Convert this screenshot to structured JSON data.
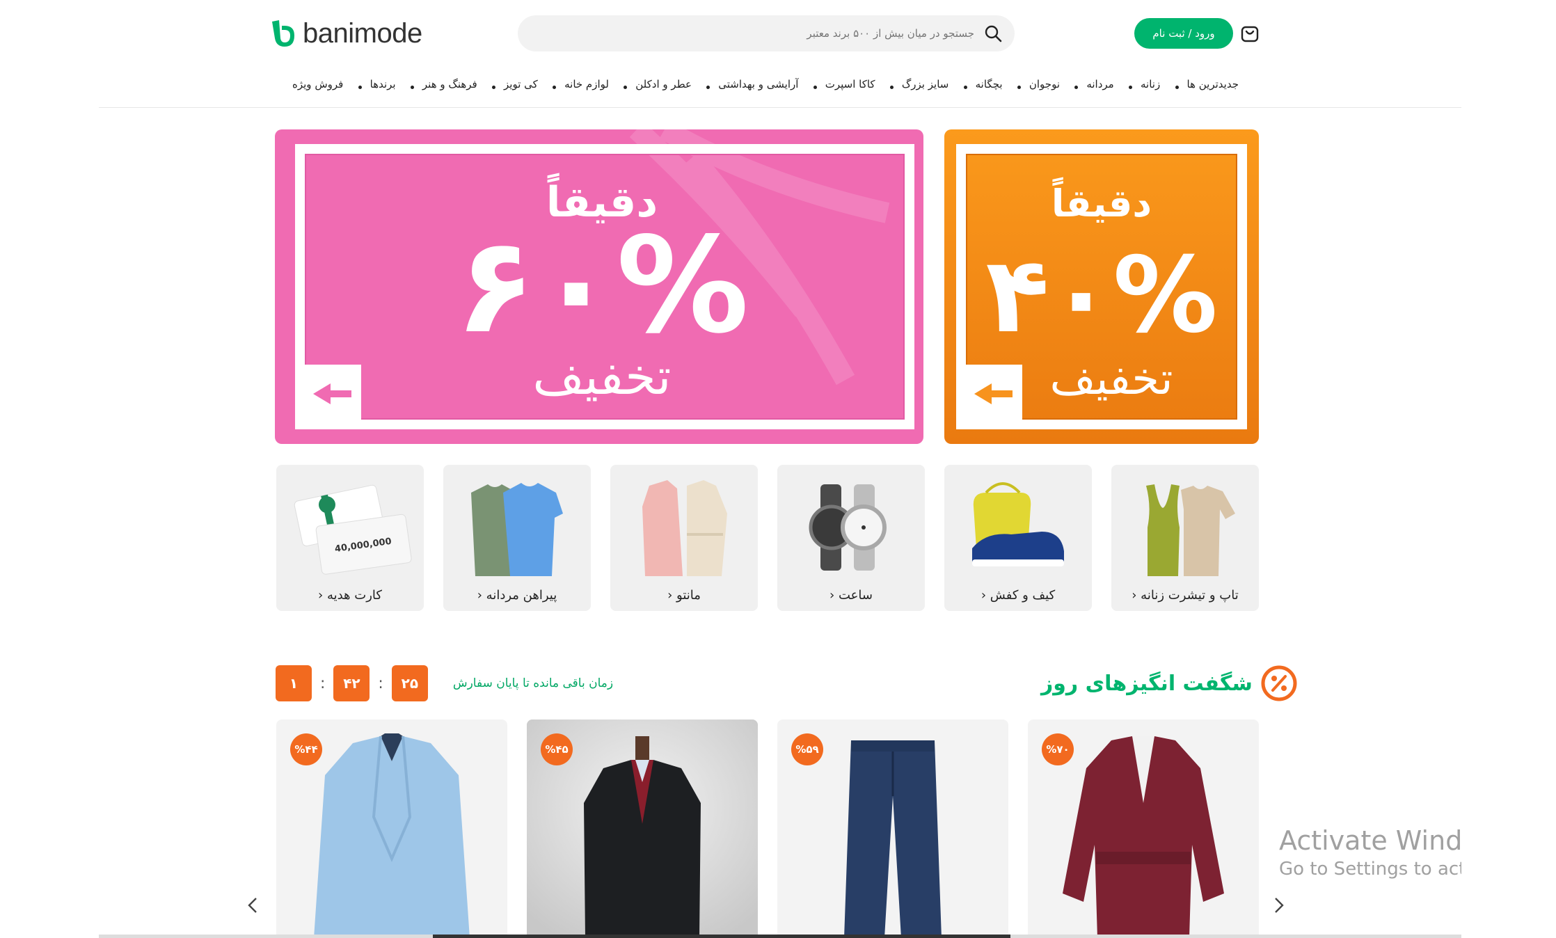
{
  "header": {
    "logo_text": "banimode",
    "search_placeholder": "جستجو در میان بیش از ۵۰۰ برند معتبر",
    "login_label": "ورود / ثبت نام",
    "brand_color": "#00b46e"
  },
  "nav": {
    "items": [
      {
        "label": "جدیدترین ها"
      },
      {
        "label": "زنانه"
      },
      {
        "label": "مردانه"
      },
      {
        "label": "نوجوان"
      },
      {
        "label": "بچگانه"
      },
      {
        "label": "سایز بزرگ"
      },
      {
        "label": "کاکا اسپرت"
      },
      {
        "label": "آرایشی و بهداشتی"
      },
      {
        "label": "عطر و ادکلن"
      },
      {
        "label": "لوازم خانه"
      },
      {
        "label": "کی تویز"
      },
      {
        "label": "فرهنگ و هنر"
      },
      {
        "label": "برندها"
      },
      {
        "label": "فروش ویژه"
      }
    ]
  },
  "banners": {
    "pink": {
      "top_text": "دقیقاً",
      "percent": "۶۰%",
      "bottom_text": "تخفیف",
      "color": "#f26cb0"
    },
    "orange": {
      "top_text": "دقیقاً",
      "percent": "۴۰%",
      "bottom_text": "تخفیف",
      "color": "#f7931e"
    }
  },
  "categories": [
    {
      "label": "تاپ و تیشرت زنانه ‹",
      "icon": "tshirt-icon"
    },
    {
      "label": "کیف و کفش ‹",
      "icon": "bag-shoe-icon"
    },
    {
      "label": "ساعت ‹",
      "icon": "watch-icon"
    },
    {
      "label": "مانتو ‹",
      "icon": "manto-icon"
    },
    {
      "label": "پیراهن مردانه ‹",
      "icon": "shirt-icon"
    },
    {
      "label": "کارت هدیه ‹",
      "icon": "gift-card-icon",
      "card_amount": "40,000,000"
    }
  ],
  "amazing": {
    "title": "شگفت انگیزهای روز",
    "timer_label": "زمان باقی مانده تا پایان سفارش",
    "timer": [
      "۱",
      "۴۲",
      "۲۵"
    ],
    "accent": "#f26a1f"
  },
  "products": [
    {
      "discount": "%۷۰",
      "name": "coat-burgundy"
    },
    {
      "discount": "%۵۹",
      "name": "jeans"
    },
    {
      "discount": "%۴۵",
      "name": "men-coat"
    },
    {
      "discount": "%۴۴",
      "name": "blazer-blue"
    }
  ],
  "watermark": {
    "line1": "Activate Windo",
    "line2": "Go to Settings to act"
  }
}
